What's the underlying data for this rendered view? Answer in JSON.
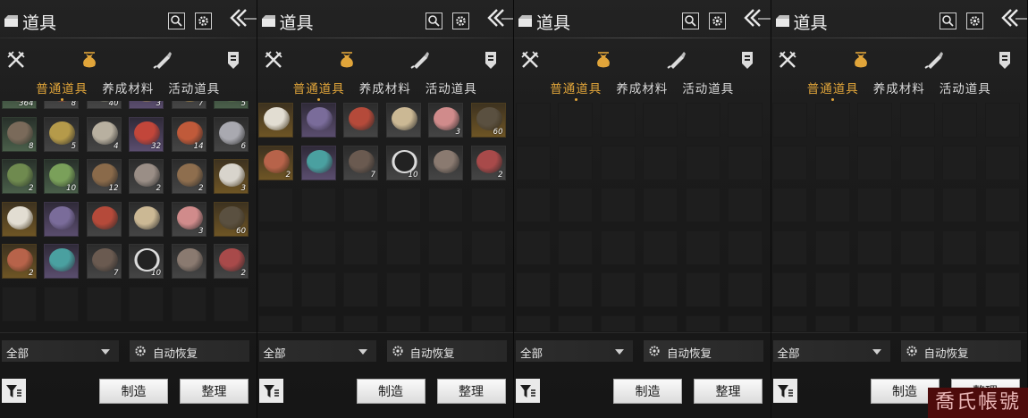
{
  "panels": [
    {
      "title": "道具",
      "tabs": [
        "普通道具",
        "养成材料",
        "活动道具"
      ],
      "active_tab": 0,
      "filter_select": "全部",
      "auto_recover": "自动恢复",
      "make_button": "制造",
      "sort_button": "整理",
      "scroll_offset": 1,
      "items": [
        {
          "icon": "brick-item",
          "quality": "green",
          "count": "364"
        },
        {
          "icon": "meat-dish-item",
          "quality": "grey",
          "count": "8"
        },
        {
          "icon": "tea-bowl-item",
          "quality": "grey",
          "count": "40"
        },
        {
          "icon": "scroll-item",
          "quality": "purple",
          "count": "3"
        },
        {
          "icon": "bun-item",
          "quality": "grey",
          "count": "7"
        },
        {
          "icon": "leaf-item",
          "quality": "green",
          "count": "5"
        },
        {
          "icon": "herb-pot-item",
          "quality": "green",
          "count": "8"
        },
        {
          "icon": "soup-bowl-item",
          "quality": "grey",
          "count": "5"
        },
        {
          "icon": "rice-bowl-item",
          "quality": "grey",
          "count": "4"
        },
        {
          "icon": "red-envelope-item",
          "quality": "purple",
          "count": "32"
        },
        {
          "icon": "sausage-item",
          "quality": "grey",
          "count": "14"
        },
        {
          "icon": "ore-item",
          "quality": "grey",
          "count": "6"
        },
        {
          "icon": "bamboo-item",
          "quality": "green",
          "count": "2"
        },
        {
          "icon": "cucumber-item",
          "quality": "green",
          "count": "10"
        },
        {
          "icon": "stew-pot-item",
          "quality": "grey",
          "count": "12"
        },
        {
          "icon": "bones-item",
          "quality": "grey",
          "count": "2"
        },
        {
          "icon": "chest-item",
          "quality": "grey",
          "count": "2"
        },
        {
          "icon": "porcelain-bowl-item",
          "quality": "gold",
          "count": "3"
        },
        {
          "icon": "plate-item",
          "quality": "gold",
          "count": ""
        },
        {
          "icon": "feather-item",
          "quality": "purple",
          "count": ""
        },
        {
          "icon": "cake-item",
          "quality": "grey",
          "count": ""
        },
        {
          "icon": "letter-item",
          "quality": "grey",
          "count": ""
        },
        {
          "icon": "pork-item",
          "quality": "grey",
          "count": "3"
        },
        {
          "icon": "helmet-item",
          "quality": "gold",
          "count": "60"
        },
        {
          "icon": "red-talisman-item",
          "quality": "gold",
          "count": "2"
        },
        {
          "icon": "jade-cloth-item",
          "quality": "purple",
          "count": ""
        },
        {
          "icon": "blade-item",
          "quality": "grey",
          "count": "7"
        },
        {
          "icon": "emblem-item",
          "quality": "grey",
          "count": "10"
        },
        {
          "icon": "fur-item",
          "quality": "grey",
          "count": ""
        },
        {
          "icon": "steak-item",
          "quality": "grey",
          "count": "2"
        }
      ]
    },
    {
      "title": "道具",
      "tabs": [
        "普通道具",
        "养成材料",
        "活动道具"
      ],
      "active_tab": 0,
      "filter_select": "全部",
      "auto_recover": "自动恢复",
      "make_button": "制造",
      "sort_button": "整理",
      "scroll_offset": 0,
      "items": [
        {
          "icon": "plate-item",
          "quality": "gold",
          "count": ""
        },
        {
          "icon": "feather-item",
          "quality": "purple",
          "count": ""
        },
        {
          "icon": "cake-item",
          "quality": "grey",
          "count": ""
        },
        {
          "icon": "letter-item",
          "quality": "grey",
          "count": ""
        },
        {
          "icon": "pork-item",
          "quality": "grey",
          "count": "3"
        },
        {
          "icon": "helmet-item",
          "quality": "gold",
          "count": "60"
        },
        {
          "icon": "red-talisman-item",
          "quality": "gold",
          "count": "2"
        },
        {
          "icon": "jade-cloth-item",
          "quality": "purple",
          "count": ""
        },
        {
          "icon": "blade-item",
          "quality": "grey",
          "count": "7"
        },
        {
          "icon": "emblem-item",
          "quality": "grey",
          "count": "10"
        },
        {
          "icon": "fur-item",
          "quality": "grey",
          "count": ""
        },
        {
          "icon": "steak-item",
          "quality": "grey",
          "count": "2"
        }
      ]
    },
    {
      "title": "道具",
      "tabs": [
        "普通道具",
        "养成材料",
        "活动道具"
      ],
      "active_tab": 0,
      "filter_select": "全部",
      "auto_recover": "自动恢复",
      "make_button": "制造",
      "sort_button": "整理",
      "scroll_offset": 0,
      "items": []
    },
    {
      "title": "道具",
      "tabs": [
        "普通道具",
        "养成材料",
        "活动道具"
      ],
      "active_tab": 0,
      "filter_select": "全部",
      "auto_recover": "自动恢复",
      "make_button": "制造",
      "sort_button": "整理",
      "scroll_offset": 0,
      "items": []
    }
  ],
  "category_icons": [
    "crossed-swords-icon",
    "pouch-icon",
    "scroll-brush-icon",
    "badge-icon"
  ],
  "active_category": 1,
  "watermark": "喬氏帳號",
  "colors": {
    "accent_gold": "#e1a53a",
    "background": "#1b1b1b",
    "watermark_bg": "#4d0b0b"
  }
}
